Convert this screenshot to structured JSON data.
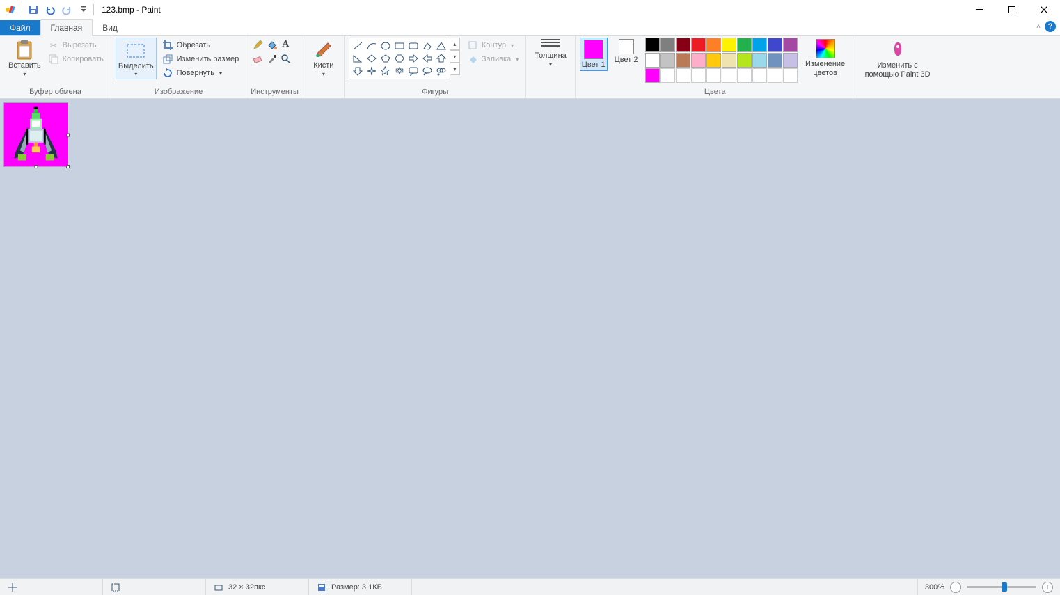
{
  "title": "123.bmp - Paint",
  "tabs": {
    "file": "Файл",
    "home": "Главная",
    "view": "Вид"
  },
  "ribbon": {
    "clipboard": {
      "label": "Буфер обмена",
      "paste": "Вставить",
      "cut": "Вырезать",
      "copy": "Копировать"
    },
    "image": {
      "label": "Изображение",
      "select": "Выделить",
      "crop": "Обрезать",
      "resize": "Изменить размер",
      "rotate": "Повернуть"
    },
    "tools": {
      "label": "Инструменты"
    },
    "brushes": {
      "label": "Кисти"
    },
    "shapes": {
      "label": "Фигуры",
      "outline": "Контур",
      "fill": "Заливка"
    },
    "thickness": {
      "label": "Толщина"
    },
    "colors": {
      "label": "Цвета",
      "c1": "Цвет 1",
      "c2": "Цвет 2",
      "c1_value": "#ff00ff",
      "c2_value": "#ffffff",
      "edit": "Изменение цветов",
      "row1": [
        "#000000",
        "#7f7f7f",
        "#880015",
        "#ed1c24",
        "#ff7f27",
        "#fff200",
        "#22b14c",
        "#00a2e8",
        "#3f48cc",
        "#a349a4"
      ],
      "row2": [
        "#ffffff",
        "#c3c3c3",
        "#b97a57",
        "#ffaec9",
        "#ffc90e",
        "#efe4b0",
        "#b5e61d",
        "#99d9ea",
        "#7092be",
        "#c8bfe7"
      ],
      "row3": [
        "#ff00ff",
        "",
        "",
        "",
        "",
        "",
        "",
        "",
        "",
        ""
      ]
    },
    "paint3d": {
      "label": "Изменить с помощью Paint 3D"
    }
  },
  "status": {
    "dimensions": "32 × 32пкс",
    "size_label": "Размер: 3,1КБ",
    "zoom": "300%",
    "zoom_thumb_pct": 50
  }
}
